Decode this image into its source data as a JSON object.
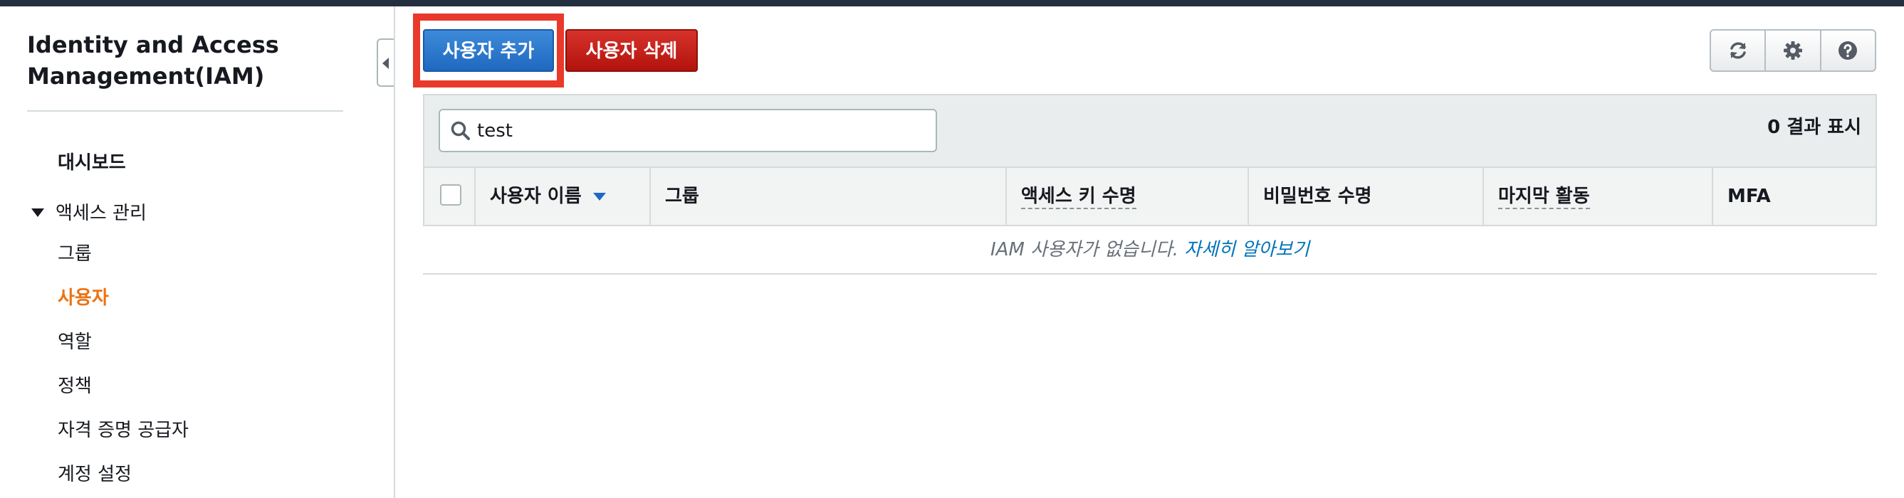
{
  "sidebar": {
    "title": "Identity and Access Management(IAM)",
    "dashboard": "대시보드",
    "access_section": "액세스 관리",
    "items": [
      {
        "label": "그룹",
        "active": false
      },
      {
        "label": "사용자",
        "active": true
      },
      {
        "label": "역할",
        "active": false
      },
      {
        "label": "정책",
        "active": false
      },
      {
        "label": "자격 증명 공급자",
        "active": false
      },
      {
        "label": "계정 설정",
        "active": false
      }
    ]
  },
  "toolbar": {
    "add_user_label": "사용자 추가",
    "delete_user_label": "사용자 삭제",
    "icons": [
      "refresh-icon",
      "gear-icon",
      "help-icon"
    ]
  },
  "search": {
    "value": "test"
  },
  "results": {
    "count_label": "0 결과 표시"
  },
  "table": {
    "columns": [
      "사용자 이름",
      "그룹",
      "액세스 키 수명",
      "비밀번호 수명",
      "마지막 활동",
      "MFA"
    ],
    "empty_message": "IAM 사용자가 없습니다.",
    "learn_more_link": "자세히 알아보기"
  },
  "colors": {
    "primary_button": "#1f69c0",
    "danger_button": "#c0150f",
    "active_nav": "#ec7211",
    "link": "#0073bb",
    "highlight": "#e8392b"
  }
}
